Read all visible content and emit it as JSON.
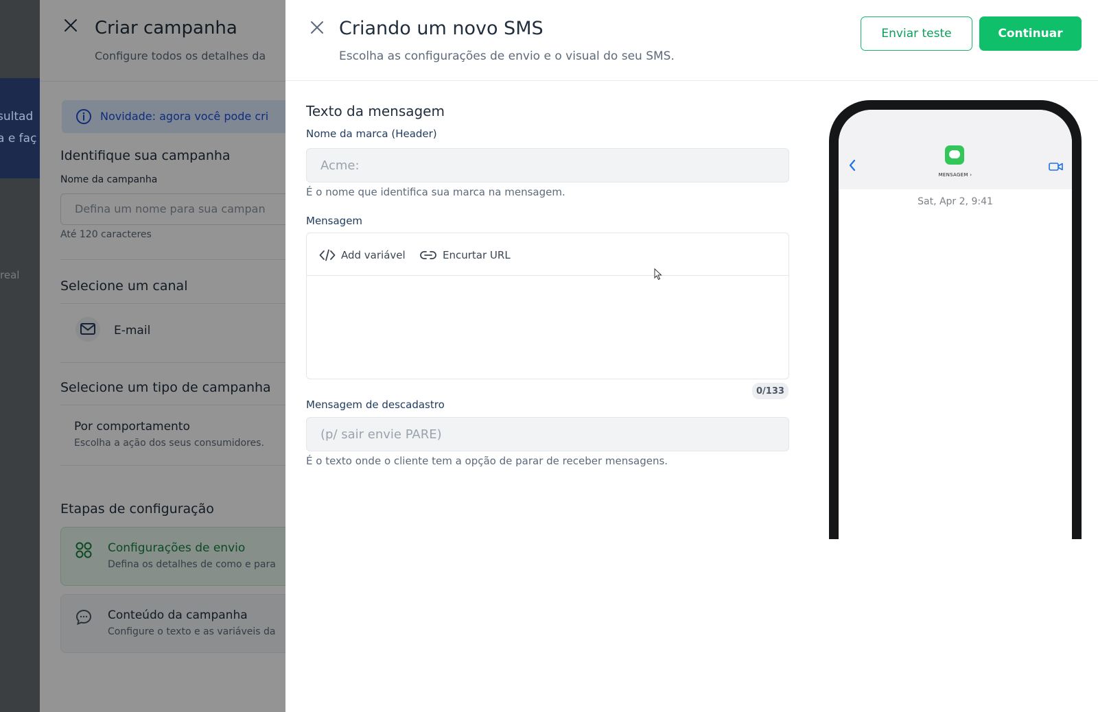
{
  "background_app": {
    "fragments": [
      "sultad",
      "a e faç",
      "real"
    ]
  },
  "campaign_panel": {
    "title": "Criar campanha",
    "subtitle": "Configure todos os detalhes da",
    "notice": "Novidade: agora você pode cri",
    "identify_heading": "Identifique sua campanha",
    "name_label": "Nome da campanha",
    "name_placeholder": "Defina um nome para sua campan",
    "name_hint": "Até 120 caracteres",
    "channel_heading": "Selecione um canal",
    "channel_email": "E-mail",
    "type_heading": "Selecione um tipo de campanha",
    "type_behavior_title": "Por comportamento",
    "type_behavior_desc": "Escolha a ação dos seus consumidores.",
    "steps_heading": "Etapas de configuração",
    "steps": [
      {
        "title": "Configurações de envio",
        "desc": "Defina os detalhes de como e para"
      },
      {
        "title": "Conteúdo da campanha",
        "desc": "Configure o texto e as variáveis da"
      }
    ]
  },
  "drawer": {
    "title": "Criando um novo SMS",
    "subtitle": "Escolha as configurações de envio e o visual do seu SMS.",
    "send_test_label": "Enviar teste",
    "continue_label": "Continuar",
    "section_title": "Texto da mensagem",
    "brand": {
      "label": "Nome da marca (Header)",
      "placeholder": "Acme:",
      "value": "",
      "help": "É o nome que identifica sua marca na mensagem."
    },
    "message": {
      "label": "Mensagem",
      "add_variable": "Add variável",
      "shorten_url": "Encurtar URL",
      "value": "",
      "counter": "0/133"
    },
    "unsubscribe": {
      "label": "Mensagem de descadastro",
      "placeholder": "(p/ sair envie PARE)",
      "value": "",
      "help": "É o texto onde o cliente tem a opção de parar de receber mensagens."
    }
  },
  "phone_preview": {
    "app_name": "MENSAGEM ›",
    "date": "Sat, Apr 2, 9:41"
  },
  "colors": {
    "primary": "#0fbf6a",
    "primary_text": "#0a9f5a",
    "ios_blue": "#1a73e8",
    "sms_green": "#33c659"
  },
  "icons": [
    "close-icon",
    "code-icon",
    "link-icon",
    "back-chevron-icon",
    "video-icon",
    "info-icon",
    "mail-icon",
    "grid-icon",
    "chat-icon",
    "mouse-cursor-icon"
  ]
}
